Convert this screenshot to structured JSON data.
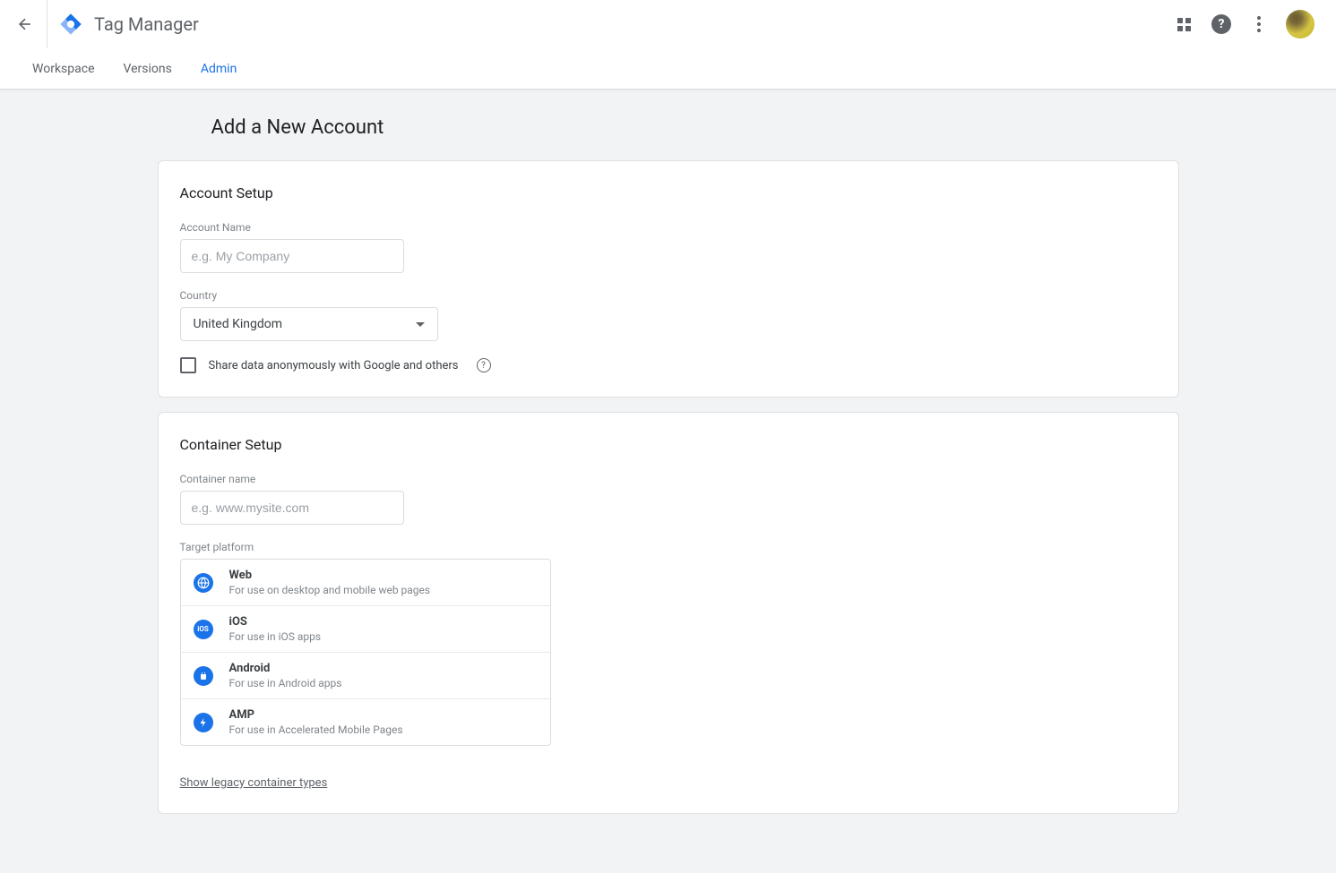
{
  "header": {
    "app_title": "Tag Manager"
  },
  "tabs": [
    {
      "label": "Workspace",
      "active": false
    },
    {
      "label": "Versions",
      "active": false
    },
    {
      "label": "Admin",
      "active": true
    }
  ],
  "page": {
    "title": "Add a New Account"
  },
  "account_setup": {
    "title": "Account Setup",
    "account_name_label": "Account Name",
    "account_name_placeholder": "e.g. My Company",
    "account_name_value": "",
    "country_label": "Country",
    "country_value": "United Kingdom",
    "share_label": "Share data anonymously with Google and others"
  },
  "container_setup": {
    "title": "Container Setup",
    "container_name_label": "Container name",
    "container_name_placeholder": "e.g. www.mysite.com",
    "container_name_value": "",
    "target_platform_label": "Target platform",
    "platforms": [
      {
        "icon": "globe-icon",
        "title": "Web",
        "desc": "For use on desktop and mobile web pages"
      },
      {
        "icon": "ios-icon",
        "title": "iOS",
        "desc": "For use in iOS apps"
      },
      {
        "icon": "android-icon",
        "title": "Android",
        "desc": "For use in Android apps"
      },
      {
        "icon": "amp-icon",
        "title": "AMP",
        "desc": "For use in Accelerated Mobile Pages"
      }
    ],
    "legacy_link": "Show legacy container types"
  }
}
